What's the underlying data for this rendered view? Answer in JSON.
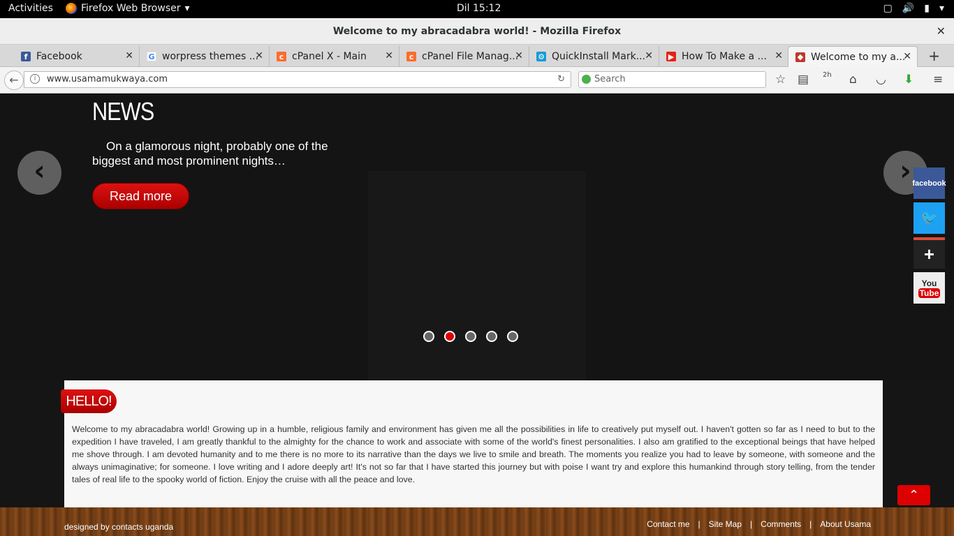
{
  "topbar": {
    "activities": "Activities",
    "app_name": "Firefox Web Browser",
    "clock": "Dil 15:12"
  },
  "window": {
    "title": "Welcome to my abracadabra world! - Mozilla Firefox"
  },
  "tabs": [
    {
      "label": "Facebook",
      "icon": "facebook-icon",
      "color": "#3b5998"
    },
    {
      "label": "worpress themes ...",
      "icon": "google-icon",
      "color": "#4285f4"
    },
    {
      "label": "cPanel X - Main",
      "icon": "cpanel-icon",
      "color": "#ff6c2c"
    },
    {
      "label": "cPanel File Manag...",
      "icon": "cpanel-icon",
      "color": "#ff6c2c"
    },
    {
      "label": "QuickInstall Mark...",
      "icon": "gear-icon",
      "color": "#1a9ad6"
    },
    {
      "label": "How To Make a ...",
      "icon": "youtube-icon",
      "color": "#e62117"
    },
    {
      "label": "Welcome to my a...",
      "icon": "site-icon",
      "color": "#c0392b"
    }
  ],
  "navbar": {
    "url": "www.usamamukwaya.com",
    "search_placeholder": "Search",
    "badge": "2h"
  },
  "slider": {
    "title": "NEWS",
    "text": "On a glamorous night, probably one of the biggest and most prominent nights…",
    "button": "Read more",
    "dots": 5,
    "active_dot": 2
  },
  "social": {
    "facebook": "facebook",
    "youtube_top": "You",
    "youtube_bottom": "Tube"
  },
  "hello": {
    "badge": "HELLO!",
    "text": "Welcome to my abracadabra world! Growing up in a humble, religious family and environment has given me all the possibilities in life to creatively put myself out. I haven't gotten so far as I need to but to the expedition I have traveled, I am greatly thankful to the almighty for the chance to work and associate with some of the world's finest personalities. I also am gratified to the exceptional beings that have helped me shove through. I am devoted humanity and to me there is no more to its narrative than the days we live to smile and breath. The moments you realize you had to leave by someone, with someone and the always unimaginative; for someone. I love writing and I adore deeply art! It's not so far that I have started this journey but with poise I want try and explore this humankind through story telling, from the tender tales of real life to the spooky world of fiction. Enjoy the cruise with all the peace and love."
  },
  "footer": {
    "credit": "designed by contacts uganda",
    "links": [
      "Contact me",
      "Site Map",
      "Comments",
      "About Usama"
    ],
    "separator": "|"
  },
  "colors": {
    "accent_red": "#dd0000",
    "page_bg": "#151515",
    "panel_bg": "#f7f7f7"
  }
}
